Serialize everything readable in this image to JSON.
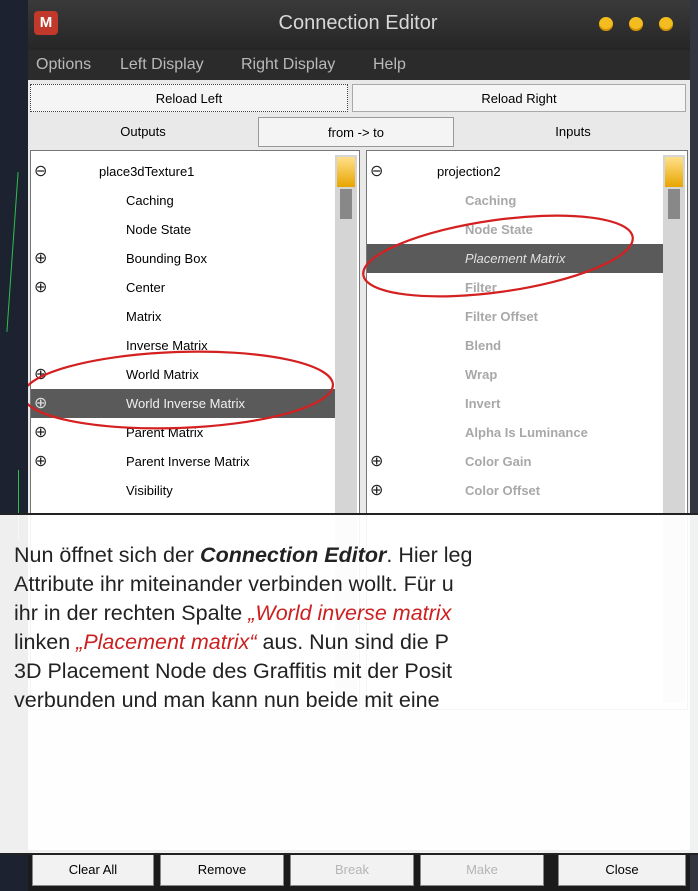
{
  "window": {
    "title": "Connection Editor"
  },
  "menu": {
    "items": [
      "Options",
      "Left Display",
      "Right Display",
      "Help"
    ]
  },
  "toolbar": {
    "reload_left": "Reload Left",
    "reload_right": "Reload Right",
    "outputs": "Outputs",
    "direction": "from -> to",
    "inputs": "Inputs"
  },
  "left_pane": {
    "rows": [
      {
        "label": "place3dTexture1",
        "expander": "⊖"
      },
      {
        "label": "Caching",
        "expander": ""
      },
      {
        "label": "Node State",
        "expander": ""
      },
      {
        "label": "Bounding Box",
        "expander": "⊕"
      },
      {
        "label": "Center",
        "expander": "⊕"
      },
      {
        "label": "Matrix",
        "expander": ""
      },
      {
        "label": "Inverse Matrix",
        "expander": ""
      },
      {
        "label": "World Matrix",
        "expander": "⊕"
      },
      {
        "label": "World Inverse Matrix",
        "expander": "⊕"
      },
      {
        "label": "Parent Matrix",
        "expander": "⊕"
      },
      {
        "label": "Parent Inverse Matrix",
        "expander": "⊕"
      },
      {
        "label": "Visibility",
        "expander": ""
      }
    ],
    "selected_index": 8
  },
  "right_pane": {
    "rows": [
      {
        "label": "projection2",
        "expander": "⊖"
      },
      {
        "label": "Caching",
        "expander": ""
      },
      {
        "label": "Node State",
        "expander": ""
      },
      {
        "label": "Placement Matrix",
        "expander": ""
      },
      {
        "label": "Filter",
        "expander": ""
      },
      {
        "label": "Filter Offset",
        "expander": ""
      },
      {
        "label": "Blend",
        "expander": ""
      },
      {
        "label": "Wrap",
        "expander": ""
      },
      {
        "label": "Invert",
        "expander": ""
      },
      {
        "label": "Alpha Is Luminance",
        "expander": ""
      },
      {
        "label": "Color Gain",
        "expander": "⊕"
      },
      {
        "label": "Color Offset",
        "expander": "⊕"
      }
    ],
    "selected_index": 3
  },
  "bottom": {
    "clear_all": "Clear All",
    "remove": "Remove",
    "break": "Break",
    "make": "Make",
    "close": "Close"
  },
  "overlay": {
    "line1_pre": "Nun öffnet sich der ",
    "line1_strong": "Connection Editor",
    "line1_post": ". Hier leg",
    "line2": "Attribute ihr miteinander verbinden wollt. Für u",
    "line3_pre": "ihr in der rechten Spalte ",
    "line3_red": "„World inverse matrix",
    "line4_pre": "linken ",
    "line4_red": "„Placement matrix“",
    "line4_post": " aus. Nun sind die P",
    "line5": "3D Placement Node des Graffitis mit der Posit",
    "line6": "verbunden und man kann nun beide mit eine"
  },
  "colors": {
    "highlight_red": "#cc2020",
    "title_button": "#f3bd20",
    "selected_row": "#5a5a5a"
  }
}
